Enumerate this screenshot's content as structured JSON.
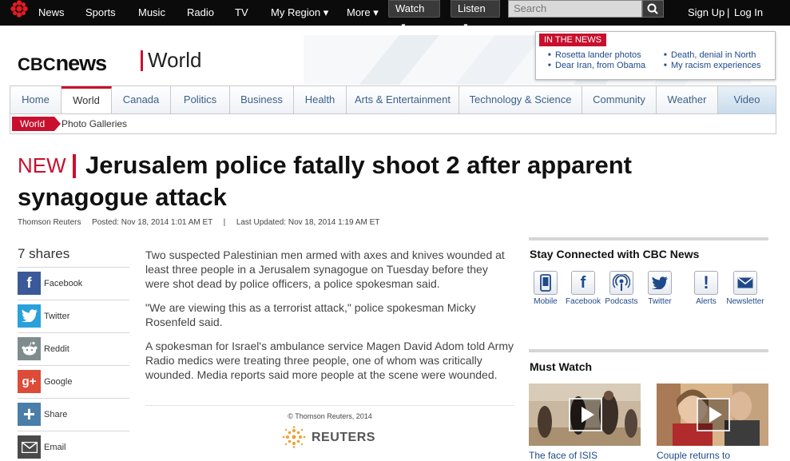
{
  "topnav": {
    "links": [
      "News",
      "Sports",
      "Music",
      "Radio",
      "TV",
      "My Region ▾",
      "More ▾"
    ],
    "watch": "Watch",
    "listen": "Listen",
    "search_placeholder": "Search",
    "sign_up": "Sign Up",
    "separator": "|",
    "log_in": "Log In"
  },
  "header": {
    "logo_cbc": "CBC",
    "logo_news": "news",
    "section": "World",
    "in_the_news": {
      "tag": "IN THE NEWS",
      "items": [
        "Rosetta lander photos",
        "Dear Iran, from Obama",
        "Death, denial in North",
        "My racism experiences"
      ]
    }
  },
  "tabs": [
    "Home",
    "World",
    "Canada",
    "Politics",
    "Business",
    "Health",
    "Arts & Entertainment",
    "Technology & Science",
    "Community",
    "Weather",
    "Video"
  ],
  "subnav": {
    "current": "World",
    "link": "Photo Galleries"
  },
  "article": {
    "badge": "NEW",
    "headline": "Jerusalem police fatally shoot 2 after apparent synagogue attack",
    "source": "Thomson Reuters",
    "posted": "Posted: Nov 18, 2014 1:01 AM ET",
    "byline_sep": "|",
    "updated": "Last Updated: Nov 18, 2014 1:19 AM ET",
    "paragraphs": [
      "Two suspected Palestinian men armed with axes and knives wounded at least three people in a Jerusalem synagogue on Tuesday before they were shot dead by police officers, a police spokesman said.",
      "\"We are viewing this as a terrorist attack,\" police spokesman Micky Rosenfeld said.",
      "A spokesman for Israel's ambulance service Magen David Adom told Army Radio medics were treating three people, one of whom was critically wounded. Media reports said more people at the scene were wounded."
    ],
    "copyright": "© Thomson Reuters, 2014",
    "reuters_logo": "REUTERS"
  },
  "share": {
    "count": "7 shares",
    "items": [
      {
        "label": "Facebook",
        "icon": "facebook-icon",
        "color": "#3b5998",
        "glyph": "f"
      },
      {
        "label": "Twitter",
        "icon": "twitter-icon",
        "color": "#2aa1db",
        "glyph": ""
      },
      {
        "label": "Reddit",
        "icon": "reddit-icon",
        "color": "#7f8c8d",
        "glyph": ""
      },
      {
        "label": "Google",
        "icon": "google-plus-icon",
        "color": "#dd4b39",
        "glyph": "g+"
      },
      {
        "label": "Share",
        "icon": "plus-icon",
        "color": "#4a7ea8",
        "glyph": "+"
      },
      {
        "label": "Email",
        "icon": "email-icon",
        "color": "#4a4a4a",
        "glyph": ""
      }
    ]
  },
  "rail": {
    "stay_connected_title": "Stay Connected with CBC News",
    "connect": [
      {
        "label": "Mobile",
        "icon": "mobile-icon"
      },
      {
        "label": "Facebook",
        "icon": "facebook-icon"
      },
      {
        "label": "Podcasts",
        "icon": "podcast-icon"
      },
      {
        "label": "Twitter",
        "icon": "twitter-icon"
      },
      {
        "label": "Alerts",
        "icon": "alert-icon"
      },
      {
        "label": "Newsletter",
        "icon": "newsletter-icon"
      }
    ],
    "must_watch_title": "Must Watch",
    "videos": [
      {
        "caption": "The face of ISIS"
      },
      {
        "caption": "Couple returns to"
      }
    ]
  },
  "colors": {
    "brand_red": "#c8102e",
    "link_blue": "#1e4a8a",
    "topbar_bg": "#0b0b0b"
  }
}
